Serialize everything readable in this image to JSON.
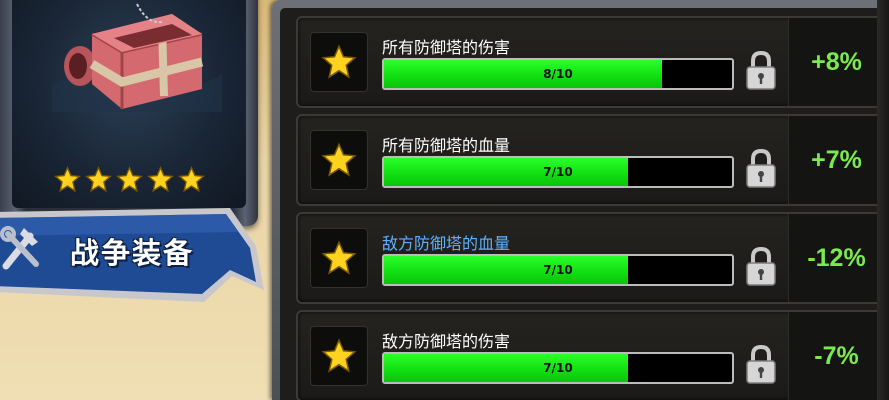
{
  "item": {
    "name": "战争装备",
    "stars": 5,
    "icon": "wrench-hammer-icon",
    "art": "war-equipment-chest-art"
  },
  "colors": {
    "bar_fill": "#11e011",
    "bonus_text": "#7bea4e",
    "highlight_label": "#5fb2ff",
    "star": "#ffd21f"
  },
  "stats": [
    {
      "label": "所有防御塔的伤害",
      "progress_text": "8/10",
      "progress": 0.8,
      "bonus": "+8%",
      "highlight": false,
      "locked": true
    },
    {
      "label": "所有防御塔的血量",
      "progress_text": "7/10",
      "progress": 0.7,
      "bonus": "+7%",
      "highlight": false,
      "locked": true
    },
    {
      "label": "敌方防御塔的血量",
      "progress_text": "7/10",
      "progress": 0.7,
      "bonus": "-12%",
      "highlight": true,
      "locked": true
    },
    {
      "label": "敌方防御塔的伤害",
      "progress_text": "7/10",
      "progress": 0.7,
      "bonus": "-7%",
      "highlight": false,
      "locked": true
    }
  ]
}
